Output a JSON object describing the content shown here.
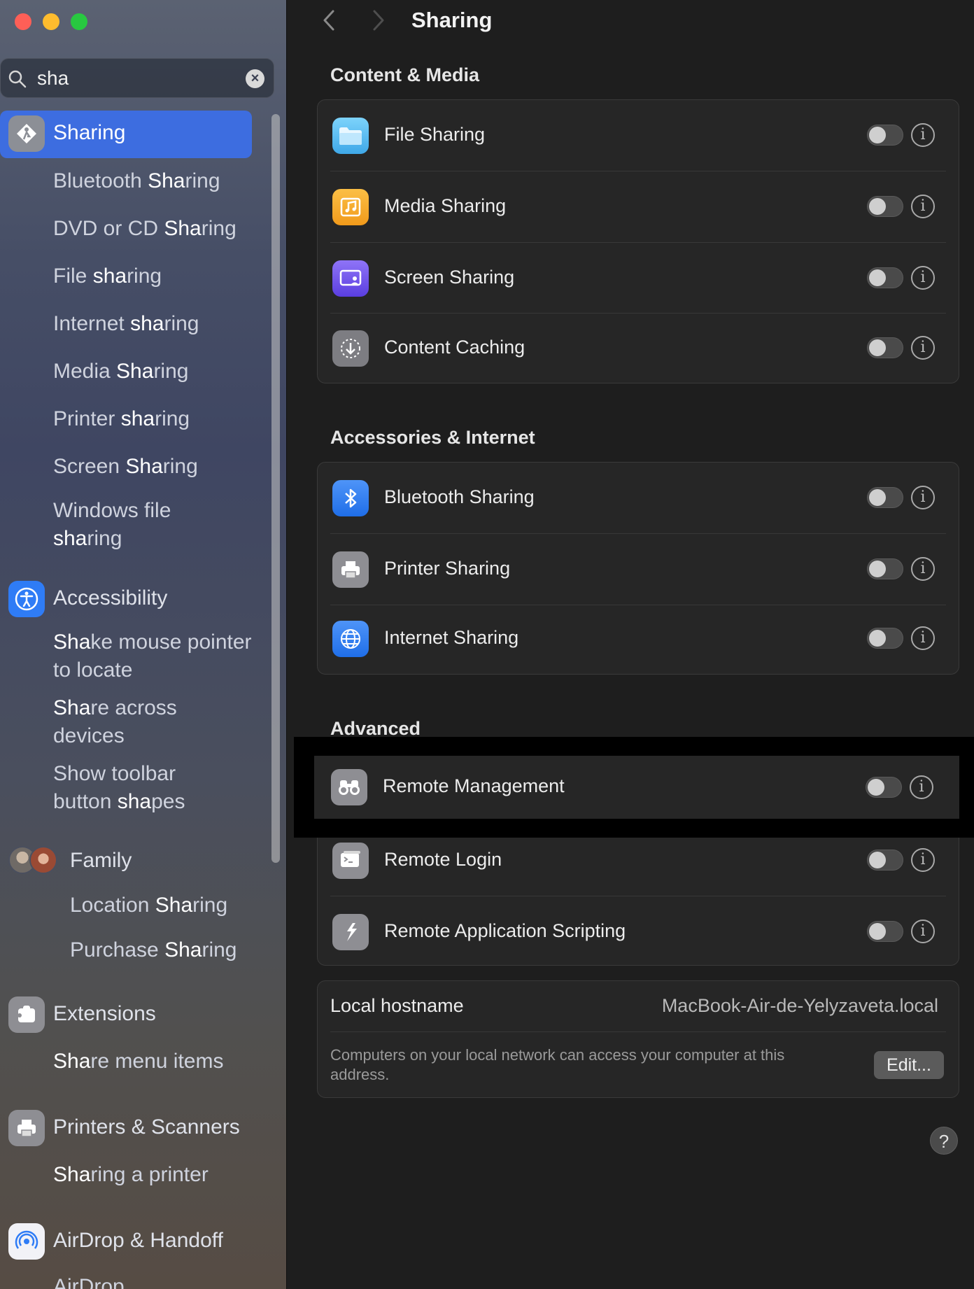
{
  "window": {
    "title": "Sharing"
  },
  "search": {
    "value": "sha"
  },
  "sidebar": {
    "selected": {
      "label_pre": "",
      "label_hl": "Sha",
      "label_post": "ring"
    },
    "items": [
      {
        "pre": "Bluetooth ",
        "hl": "Sha",
        "post": "ring"
      },
      {
        "pre": "DVD or CD ",
        "hl": "Sha",
        "post": "ring"
      },
      {
        "pre": "File ",
        "hl": "sha",
        "post": "ring"
      },
      {
        "pre": "Internet ",
        "hl": "sha",
        "post": "ring"
      },
      {
        "pre": "Media ",
        "hl": "Sha",
        "post": "ring"
      },
      {
        "pre": "Printer ",
        "hl": "sha",
        "post": "ring"
      },
      {
        "pre": "Screen ",
        "hl": "Sha",
        "post": "ring"
      },
      {
        "pre": "Windows file ",
        "hl": "sha",
        "post": "ring"
      }
    ],
    "accessibility": {
      "label": "Accessibility",
      "items": [
        {
          "pre": "",
          "hl": "Sha",
          "post": "ke mouse pointer to locate"
        },
        {
          "pre": "",
          "hl": "Sha",
          "post": "re across devices"
        },
        {
          "pre": "Show toolbar button ",
          "hl": "sha",
          "post": "pes"
        }
      ]
    },
    "family": {
      "label": "Family",
      "items": [
        {
          "pre": "Location ",
          "hl": "Sha",
          "post": "ring"
        },
        {
          "pre": "Purchase ",
          "hl": "Sha",
          "post": "ring"
        }
      ]
    },
    "extensions": {
      "label": "Extensions",
      "items": [
        {
          "pre": "",
          "hl": "Sha",
          "post": "re menu items"
        }
      ]
    },
    "printers": {
      "label": "Printers & Scanners",
      "items": [
        {
          "pre": "",
          "hl": "Sha",
          "post": "ring a printer"
        }
      ]
    },
    "airdrop": {
      "label": "AirDrop & Handoff",
      "items": [
        {
          "label": "AirDrop"
        }
      ]
    }
  },
  "sections": [
    {
      "title": "Content & Media",
      "rows": [
        {
          "label": "File Sharing",
          "icon": "folder-icon",
          "on": false
        },
        {
          "label": "Media Sharing",
          "icon": "music-icon",
          "on": false
        },
        {
          "label": "Screen Sharing",
          "icon": "screen-share-icon",
          "on": false
        },
        {
          "label": "Content Caching",
          "icon": "download-icon",
          "on": false
        }
      ]
    },
    {
      "title": "Accessories & Internet",
      "rows": [
        {
          "label": "Bluetooth Sharing",
          "icon": "bluetooth-icon",
          "on": false
        },
        {
          "label": "Printer Sharing",
          "icon": "printer-icon",
          "on": false
        },
        {
          "label": "Internet Sharing",
          "icon": "globe-icon",
          "on": false
        }
      ]
    },
    {
      "title": "Advanced",
      "rows": [
        {
          "label": "Remote Management",
          "icon": "binoculars-icon",
          "on": false
        },
        {
          "label": "Remote Login",
          "icon": "terminal-icon",
          "on": false
        },
        {
          "label": "Remote Application Scripting",
          "icon": "script-icon",
          "on": false
        }
      ]
    }
  ],
  "hostname": {
    "label": "Local hostname",
    "value": "MacBook-Air-de-Yelyzaveta.local",
    "note": "Computers on your local network can access your computer at this address.",
    "edit_label": "Edit..."
  },
  "help_label": "?",
  "colors": {
    "accent": "#3d6de0",
    "file_sharing": "#5fc3f2",
    "media_sharing": "#f5a623",
    "screen_sharing": "#7a5cf0",
    "bluetooth": "#2f7cf6",
    "internet": "#2f7cf6",
    "gray_icon": "#8e8e93"
  }
}
